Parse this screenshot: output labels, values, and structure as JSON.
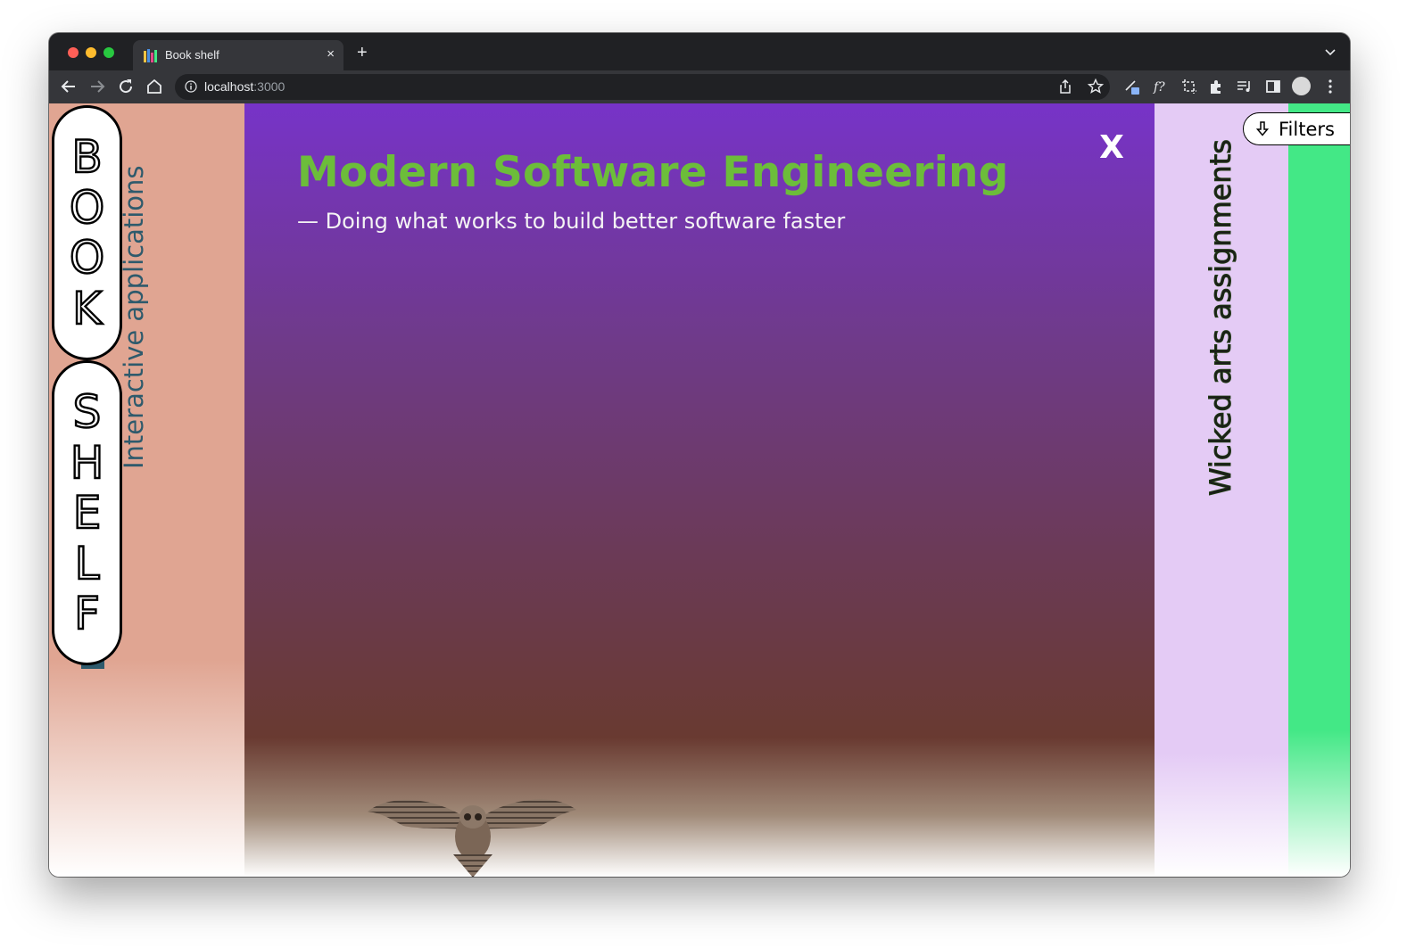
{
  "browser": {
    "tab_title": "Book shelf",
    "tab_close": "×",
    "new_tab": "+",
    "url_host": "localhost",
    "url_port": ":3000"
  },
  "app": {
    "logo_top_letters": [
      "B",
      "O",
      "O",
      "K"
    ],
    "logo_bottom_letters": [
      "S",
      "H",
      "E",
      "L",
      "F"
    ],
    "left_shelf_title": "Interactive applications",
    "right_shelf_title": "Wicked arts assignments",
    "filters_label": "Filters",
    "close_label": "X"
  },
  "book": {
    "title": "Modern Software Engineering",
    "subtitle": "— Doing what works to build better software faster"
  },
  "colors": {
    "left_shelf": "#e0a592",
    "main_top": "#7733c8",
    "main_bottom": "#693a31",
    "title_green": "#6cbd3a",
    "purple_shelf": "#e4cbf5",
    "green_shelf": "#43e886",
    "left_title": "#2e5a6c"
  }
}
